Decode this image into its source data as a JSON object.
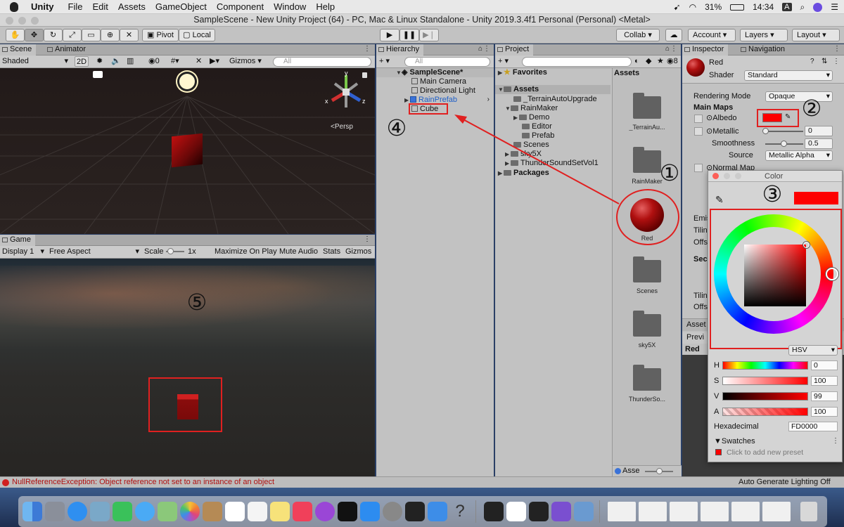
{
  "menubar": {
    "app": "Unity",
    "items": [
      "File",
      "Edit",
      "Assets",
      "GameObject",
      "Component",
      "Window",
      "Help"
    ],
    "battery": "31%",
    "time": "14:34",
    "input": "A"
  },
  "window": {
    "title": "SampleScene - New Unity Project (64) - PC, Mac & Linux Standalone - Unity 2019.3.4f1 Personal (Personal) <Metal>"
  },
  "toolbar": {
    "pivot": "Pivot",
    "local": "Local",
    "collab": "Collab ▾",
    "account": "Account",
    "layers": "Layers",
    "layout": "Layout"
  },
  "scene": {
    "tabs": [
      "Scene",
      "Animator"
    ],
    "shading": "Shaded",
    "mode_2d": "2D",
    "hidden_count": "0",
    "gizmos": "Gizmos",
    "search_placeholder": "All",
    "persp": "<Persp",
    "gizmo_axes": [
      "y",
      "x",
      "z"
    ]
  },
  "game": {
    "tab": "Game",
    "display": "Display 1",
    "aspect": "Free Aspect",
    "scale_label": "Scale",
    "scale_value": "1x",
    "maximize": "Maximize On Play",
    "mute": "Mute Audio",
    "stats": "Stats",
    "gizmos": "Gizmos"
  },
  "hierarchy": {
    "tab": "Hierarchy",
    "search_placeholder": "All",
    "scene_name": "SampleScene*",
    "items": [
      "Main Camera",
      "Directional Light",
      "RainPrefab",
      "Cube"
    ]
  },
  "project": {
    "tab": "Project",
    "hidden_count": "8",
    "favorites": "Favorites",
    "assets": "Assets",
    "tree": [
      "_TerrainAutoUpgrade",
      "RainMaker",
      "Demo",
      "Editor",
      "Prefab",
      "Scenes",
      "sky5X",
      "ThunderSoundSetVol1"
    ],
    "packages": "Packages",
    "grid_header": "Assets",
    "grid_items": [
      "_TerrainAu...",
      "RainMaker",
      "Red",
      "Scenes",
      "sky5X",
      "ThunderSo..."
    ],
    "footer": "Asse"
  },
  "inspector": {
    "tabs": [
      "Inspector",
      "Navigation"
    ],
    "material_name": "Red",
    "shader_label": "Shader",
    "shader_value": "Standard",
    "rendering_mode_label": "Rendering Mode",
    "rendering_mode_value": "Opaque",
    "main_maps": "Main Maps",
    "albedo": "Albedo",
    "metallic": "Metallic",
    "metallic_value": "0",
    "smoothness": "Smoothness",
    "smoothness_value": "0.5",
    "source": "Source",
    "source_value": "Metallic Alpha",
    "normal_map": "Normal Map",
    "emission": "Emis",
    "tiling1": "Tilin",
    "offset1": "Offs",
    "secondary": "Sec",
    "tiling2": "Tilin",
    "offset2": "Offs",
    "asset_label": "Asset",
    "preview": "Previ",
    "red_label": "Red"
  },
  "color_picker": {
    "title": "Color",
    "mode": "HSV",
    "h_label": "H",
    "h_value": "0",
    "s_label": "S",
    "s_value": "100",
    "v_label": "V",
    "v_value": "99",
    "a_label": "A",
    "a_value": "100",
    "hex_label": "Hexadecimal",
    "hex_value": "FD0000",
    "swatches": "Swatches",
    "add_preset": "Click to add new preset",
    "color": "#FD0000"
  },
  "annotations": [
    "①",
    "②",
    "③",
    "④",
    "⑤"
  ],
  "status": {
    "error": "NullReferenceException: Object reference not set to an instance of an object",
    "lighting": "Auto Generate Lighting Off"
  },
  "colors": {
    "accent_red": "#e02020",
    "material_red": "#fd0000",
    "selection_blue": "#3a72d8",
    "prefab_blue": "#2060c8"
  }
}
